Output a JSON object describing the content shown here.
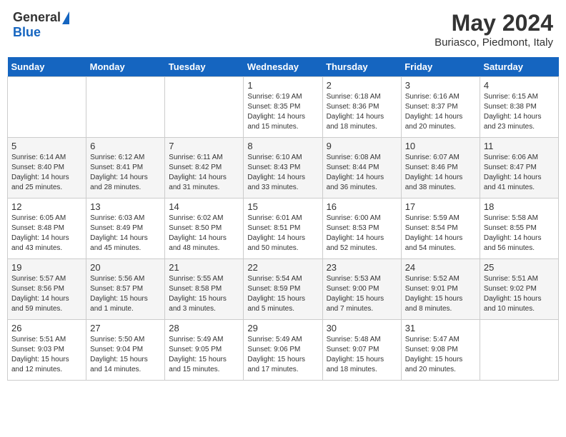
{
  "header": {
    "logo_general": "General",
    "logo_blue": "Blue",
    "title": "May 2024",
    "subtitle": "Buriasco, Piedmont, Italy"
  },
  "days_of_week": [
    "Sunday",
    "Monday",
    "Tuesday",
    "Wednesday",
    "Thursday",
    "Friday",
    "Saturday"
  ],
  "weeks": [
    {
      "shaded": false,
      "days": [
        {
          "number": "",
          "sunrise": "",
          "sunset": "",
          "daylight": ""
        },
        {
          "number": "",
          "sunrise": "",
          "sunset": "",
          "daylight": ""
        },
        {
          "number": "",
          "sunrise": "",
          "sunset": "",
          "daylight": ""
        },
        {
          "number": "1",
          "sunrise": "Sunrise: 6:19 AM",
          "sunset": "Sunset: 8:35 PM",
          "daylight": "Daylight: 14 hours and 15 minutes."
        },
        {
          "number": "2",
          "sunrise": "Sunrise: 6:18 AM",
          "sunset": "Sunset: 8:36 PM",
          "daylight": "Daylight: 14 hours and 18 minutes."
        },
        {
          "number": "3",
          "sunrise": "Sunrise: 6:16 AM",
          "sunset": "Sunset: 8:37 PM",
          "daylight": "Daylight: 14 hours and 20 minutes."
        },
        {
          "number": "4",
          "sunrise": "Sunrise: 6:15 AM",
          "sunset": "Sunset: 8:38 PM",
          "daylight": "Daylight: 14 hours and 23 minutes."
        }
      ]
    },
    {
      "shaded": true,
      "days": [
        {
          "number": "5",
          "sunrise": "Sunrise: 6:14 AM",
          "sunset": "Sunset: 8:40 PM",
          "daylight": "Daylight: 14 hours and 25 minutes."
        },
        {
          "number": "6",
          "sunrise": "Sunrise: 6:12 AM",
          "sunset": "Sunset: 8:41 PM",
          "daylight": "Daylight: 14 hours and 28 minutes."
        },
        {
          "number": "7",
          "sunrise": "Sunrise: 6:11 AM",
          "sunset": "Sunset: 8:42 PM",
          "daylight": "Daylight: 14 hours and 31 minutes."
        },
        {
          "number": "8",
          "sunrise": "Sunrise: 6:10 AM",
          "sunset": "Sunset: 8:43 PM",
          "daylight": "Daylight: 14 hours and 33 minutes."
        },
        {
          "number": "9",
          "sunrise": "Sunrise: 6:08 AM",
          "sunset": "Sunset: 8:44 PM",
          "daylight": "Daylight: 14 hours and 36 minutes."
        },
        {
          "number": "10",
          "sunrise": "Sunrise: 6:07 AM",
          "sunset": "Sunset: 8:46 PM",
          "daylight": "Daylight: 14 hours and 38 minutes."
        },
        {
          "number": "11",
          "sunrise": "Sunrise: 6:06 AM",
          "sunset": "Sunset: 8:47 PM",
          "daylight": "Daylight: 14 hours and 41 minutes."
        }
      ]
    },
    {
      "shaded": false,
      "days": [
        {
          "number": "12",
          "sunrise": "Sunrise: 6:05 AM",
          "sunset": "Sunset: 8:48 PM",
          "daylight": "Daylight: 14 hours and 43 minutes."
        },
        {
          "number": "13",
          "sunrise": "Sunrise: 6:03 AM",
          "sunset": "Sunset: 8:49 PM",
          "daylight": "Daylight: 14 hours and 45 minutes."
        },
        {
          "number": "14",
          "sunrise": "Sunrise: 6:02 AM",
          "sunset": "Sunset: 8:50 PM",
          "daylight": "Daylight: 14 hours and 48 minutes."
        },
        {
          "number": "15",
          "sunrise": "Sunrise: 6:01 AM",
          "sunset": "Sunset: 8:51 PM",
          "daylight": "Daylight: 14 hours and 50 minutes."
        },
        {
          "number": "16",
          "sunrise": "Sunrise: 6:00 AM",
          "sunset": "Sunset: 8:53 PM",
          "daylight": "Daylight: 14 hours and 52 minutes."
        },
        {
          "number": "17",
          "sunrise": "Sunrise: 5:59 AM",
          "sunset": "Sunset: 8:54 PM",
          "daylight": "Daylight: 14 hours and 54 minutes."
        },
        {
          "number": "18",
          "sunrise": "Sunrise: 5:58 AM",
          "sunset": "Sunset: 8:55 PM",
          "daylight": "Daylight: 14 hours and 56 minutes."
        }
      ]
    },
    {
      "shaded": true,
      "days": [
        {
          "number": "19",
          "sunrise": "Sunrise: 5:57 AM",
          "sunset": "Sunset: 8:56 PM",
          "daylight": "Daylight: 14 hours and 59 minutes."
        },
        {
          "number": "20",
          "sunrise": "Sunrise: 5:56 AM",
          "sunset": "Sunset: 8:57 PM",
          "daylight": "Daylight: 15 hours and 1 minute."
        },
        {
          "number": "21",
          "sunrise": "Sunrise: 5:55 AM",
          "sunset": "Sunset: 8:58 PM",
          "daylight": "Daylight: 15 hours and 3 minutes."
        },
        {
          "number": "22",
          "sunrise": "Sunrise: 5:54 AM",
          "sunset": "Sunset: 8:59 PM",
          "daylight": "Daylight: 15 hours and 5 minutes."
        },
        {
          "number": "23",
          "sunrise": "Sunrise: 5:53 AM",
          "sunset": "Sunset: 9:00 PM",
          "daylight": "Daylight: 15 hours and 7 minutes."
        },
        {
          "number": "24",
          "sunrise": "Sunrise: 5:52 AM",
          "sunset": "Sunset: 9:01 PM",
          "daylight": "Daylight: 15 hours and 8 minutes."
        },
        {
          "number": "25",
          "sunrise": "Sunrise: 5:51 AM",
          "sunset": "Sunset: 9:02 PM",
          "daylight": "Daylight: 15 hours and 10 minutes."
        }
      ]
    },
    {
      "shaded": false,
      "days": [
        {
          "number": "26",
          "sunrise": "Sunrise: 5:51 AM",
          "sunset": "Sunset: 9:03 PM",
          "daylight": "Daylight: 15 hours and 12 minutes."
        },
        {
          "number": "27",
          "sunrise": "Sunrise: 5:50 AM",
          "sunset": "Sunset: 9:04 PM",
          "daylight": "Daylight: 15 hours and 14 minutes."
        },
        {
          "number": "28",
          "sunrise": "Sunrise: 5:49 AM",
          "sunset": "Sunset: 9:05 PM",
          "daylight": "Daylight: 15 hours and 15 minutes."
        },
        {
          "number": "29",
          "sunrise": "Sunrise: 5:49 AM",
          "sunset": "Sunset: 9:06 PM",
          "daylight": "Daylight: 15 hours and 17 minutes."
        },
        {
          "number": "30",
          "sunrise": "Sunrise: 5:48 AM",
          "sunset": "Sunset: 9:07 PM",
          "daylight": "Daylight: 15 hours and 18 minutes."
        },
        {
          "number": "31",
          "sunrise": "Sunrise: 5:47 AM",
          "sunset": "Sunset: 9:08 PM",
          "daylight": "Daylight: 15 hours and 20 minutes."
        },
        {
          "number": "",
          "sunrise": "",
          "sunset": "",
          "daylight": ""
        }
      ]
    }
  ]
}
